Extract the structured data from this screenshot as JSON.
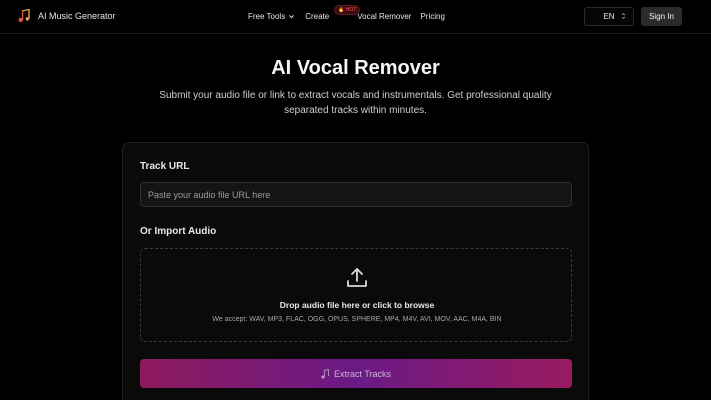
{
  "header": {
    "brand_name": "AI Music Generator",
    "nav": {
      "free_tools": "Free Tools",
      "create": "Create",
      "hot_badge": "🔥 HOT",
      "vocal_remover": "Vocal Remover",
      "pricing": "Pricing"
    },
    "language": "EN",
    "sign_in": "Sign In"
  },
  "hero": {
    "title": "AI Vocal Remover",
    "subtitle": "Submit your audio file or link to extract vocals and instrumentals. Get professional quality separated tracks within minutes."
  },
  "form": {
    "track_url_label": "Track URL",
    "url_placeholder": "Paste your audio file URL here",
    "import_label": "Or Import Audio",
    "drop_title": "Drop audio file here or click to browse",
    "accepted_formats": "We accept: WAV, MP3, FLAC, OGG, OPUS, SPHERE, MP4, M4V, AVI, MOV, AAC, M4A, BIN",
    "extract_button": "Extract Tracks"
  },
  "colors": {
    "background": "#000000",
    "card": "#0a0a0a",
    "button_gradient": [
      "#8e1a5d",
      "#6a1a86",
      "#9a1a5f"
    ],
    "hot_badge": "#ff5a5a"
  },
  "icons": [
    "music-note-icon",
    "chevron-down-icon",
    "select-caret-icon",
    "upload-icon"
  ]
}
